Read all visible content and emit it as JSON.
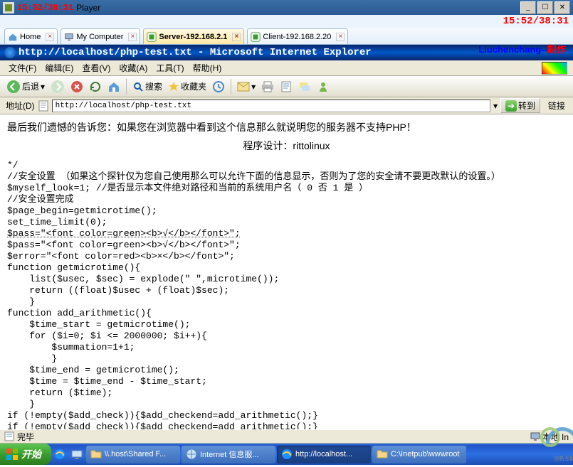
{
  "player_window": {
    "title_time": "15:52/38:31",
    "title_app": "Player",
    "timestamp_top_right": "15:52/38:31",
    "credit": "Liuchenchang--",
    "credit_suffix": "制作"
  },
  "vm_tabs": [
    {
      "icon": "home-icon",
      "label": "Home",
      "closable": true,
      "active": false
    },
    {
      "icon": "computer-icon",
      "label": "My Computer",
      "closable": true,
      "active": false
    },
    {
      "icon": "vm-icon",
      "label": "Server-192.168.2.1",
      "closable": true,
      "active": true
    },
    {
      "icon": "vm-icon",
      "label": "Client-192.168.2.20",
      "closable": true,
      "active": false
    }
  ],
  "ie": {
    "title": "http://localhost/php-test.txt - Microsoft Internet Explorer",
    "menu_items": [
      "文件(F)",
      "编辑(E)",
      "查看(V)",
      "收藏(A)",
      "工具(T)",
      "帮助(H)"
    ],
    "toolbar": {
      "back": "后退",
      "search": "搜索",
      "favorites": "收藏夹"
    },
    "addr_label": "地址(D)",
    "addr_value": "http://localhost/php-test.txt",
    "go_label": "转到",
    "links_label": "链接",
    "status_done": "完毕",
    "status_zone": "本地 In"
  },
  "page": {
    "notice": "最后我们遗憾的告诉您：如果您在浏览器中看到这个信息那么就说明您的服务器不支持PHP！",
    "designer": "程序设计：rittolinux",
    "lines": [
      "*/",
      "//安全设置 （如果这个探针仅为您自己使用那么可以允许下面的信息显示，否则为了您的安全请不要更改默认的设置。）",
      "$myself_look=1; //是否显示本文件绝对路径和当前的系统用户名（ 0 否 1 是 ）",
      "//安全设置完成",
      "$page_begin=getmicrotime();",
      "set_time_limit(0);",
      "$pass=\"<font color=green><b>√</b></font>\";",
      "$pass=\"<font color=green><b>√</b></font>\";",
      "$error=\"<font color=red><b>×</b></font>\";",
      "function getmicrotime(){",
      "    list($usec, $sec) = explode(\" \",microtime());",
      "    return ((float)$usec + (float)$sec);",
      "    }",
      "function add_arithmetic(){",
      "    $time_start = getmicrotime();",
      "    for ($i=0; $i <= 2000000; $i++){",
      "        $summation=1+1;",
      "        }",
      "    $time_end = getmicrotime();",
      "    $time = $time_end - $time_start;",
      "    return ($time);",
      "    }",
      "if (!empty($add_check)){$add_checkend=add_arithmetic();}",
      "if (!empty($add_check)){$add_checkend=add_arithmetic();}"
    ]
  },
  "taskbar": {
    "start": "开始",
    "tasks": [
      {
        "icon": "folder-icon",
        "label": "\\\\.host\\Shared F...",
        "active": false
      },
      {
        "icon": "iis-icon",
        "label": "Internet 信息服...",
        "active": false
      },
      {
        "icon": "ie-icon",
        "label": "http://localhost...",
        "active": true
      },
      {
        "icon": "folder-icon",
        "label": "C:\\Inetpub\\wwwroot",
        "active": false
      }
    ]
  },
  "watermark": {
    "brand": "创新互联"
  }
}
